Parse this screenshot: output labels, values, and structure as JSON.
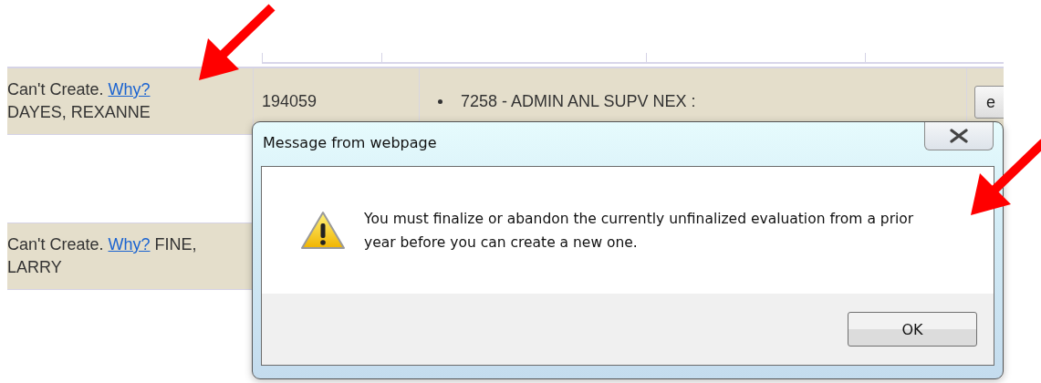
{
  "table": {
    "rows": [
      {
        "status": "Can't Create.",
        "link": "Why?",
        "name": "DAYES, REXANNE",
        "name_on_new_line": true,
        "employee_id": "194059",
        "position": "7258 - ADMIN ANL SUPV NEX :",
        "action": "e"
      },
      {
        "status": "Can't Create.",
        "link": "Why?",
        "name": "FINE, LARRY",
        "name_on_new_line": false
      }
    ]
  },
  "dialog": {
    "title": "Message from webpage",
    "message": "You must finalize or abandon the currently unfinalized evaluation from a prior year before you can create a new one.",
    "buttons": [
      "OK"
    ]
  },
  "annotations": [
    {
      "kind": "arrow"
    },
    {
      "kind": "arrow"
    }
  ]
}
